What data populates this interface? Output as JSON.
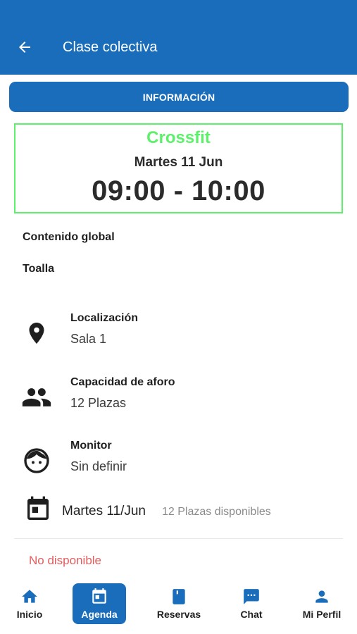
{
  "appbar": {
    "title": "Clase colectiva"
  },
  "tab": {
    "label": "INFORMACIÓN"
  },
  "class_card": {
    "name": "Crossfit",
    "date": "Martes 11 Jun",
    "time": "09:00 - 10:00"
  },
  "content": {
    "global_label": "Contenido global",
    "item": "Toalla"
  },
  "details": [
    {
      "title": "Localización",
      "value": "Sala 1",
      "icon": "location-pin-icon"
    },
    {
      "title": "Capacidad de aforo",
      "value": "12 Plazas",
      "icon": "people-icon"
    },
    {
      "title": "Monitor",
      "value": "Sin definir",
      "icon": "face-icon"
    }
  ],
  "session": {
    "date": "Martes 11/Jun",
    "seats": "12 Plazas disponibles",
    "icon": "calendar-icon"
  },
  "status": {
    "text": "No disponible",
    "color": "#e25c5c"
  },
  "bottom_nav": [
    {
      "label": "Inicio",
      "icon": "home-icon",
      "active": false
    },
    {
      "label": "Agenda",
      "icon": "calendar-icon",
      "active": true
    },
    {
      "label": "Reservas",
      "icon": "book-icon",
      "active": false
    },
    {
      "label": "Chat",
      "icon": "chat-icon",
      "active": false
    },
    {
      "label": "Mi Perfil",
      "icon": "person-icon",
      "active": false
    }
  ],
  "colors": {
    "primary": "#1a6dba",
    "accent_green": "#5df06b",
    "error": "#e25c5c"
  }
}
